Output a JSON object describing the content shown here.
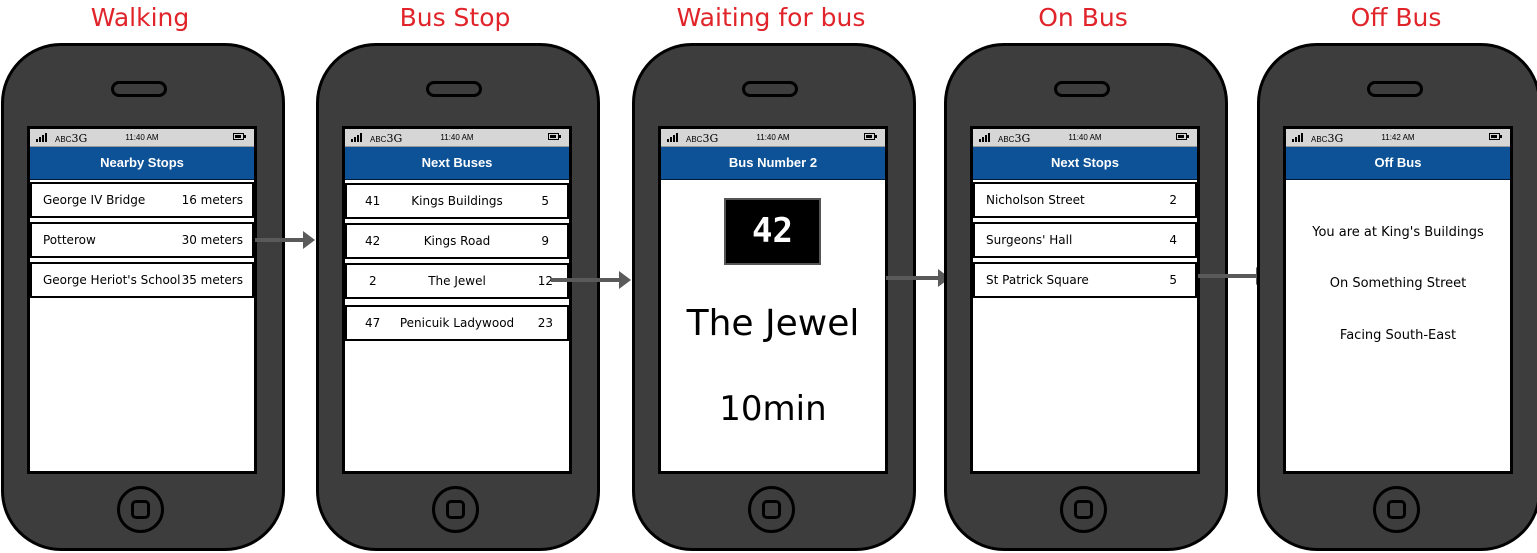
{
  "status": {
    "carrier_prefix": "ABC",
    "network": "3G"
  },
  "screens": [
    {
      "caption": "Walking",
      "time": "11:40 AM",
      "title": "Nearby Stops",
      "items": [
        {
          "name": "George IV Bridge",
          "distance": "16 meters"
        },
        {
          "name": "Potterow",
          "distance": "30 meters"
        },
        {
          "name": "George Heriot's School",
          "distance": "35 meters"
        }
      ]
    },
    {
      "caption": "Bus Stop",
      "time": "11:40 AM",
      "title": "Next Buses",
      "items": [
        {
          "number": "41",
          "destination": "Kings Buildings",
          "minutes": "5"
        },
        {
          "number": "42",
          "destination": "Kings Road",
          "minutes": "9"
        },
        {
          "number": "2",
          "destination": "The Jewel",
          "minutes": "12"
        },
        {
          "number": "47",
          "destination": "Penicuik Ladywood",
          "minutes": "23"
        }
      ]
    },
    {
      "caption": "Waiting for bus",
      "time": "11:40 AM",
      "title": "Bus Number 2",
      "bus_number": "42",
      "destination": "The Jewel",
      "wait": "10min"
    },
    {
      "caption": "On Bus",
      "time": "11:40 AM",
      "title": "Next Stops",
      "items": [
        {
          "name": "Nicholson Street",
          "stops": "2"
        },
        {
          "name": "Surgeons' Hall",
          "stops": "4"
        },
        {
          "name": "St Patrick Square",
          "stops": "5"
        }
      ]
    },
    {
      "caption": "Off Bus",
      "time": "11:42 AM",
      "title": "Off Bus",
      "lines": [
        "You are at King's Buildings",
        "On Something Street",
        "Facing South-East"
      ]
    }
  ],
  "colors": {
    "caption": "#e0242a",
    "titlebar": "#0d5297",
    "phone_body": "#3d3d3d",
    "arrow": "#5a5a5a"
  }
}
